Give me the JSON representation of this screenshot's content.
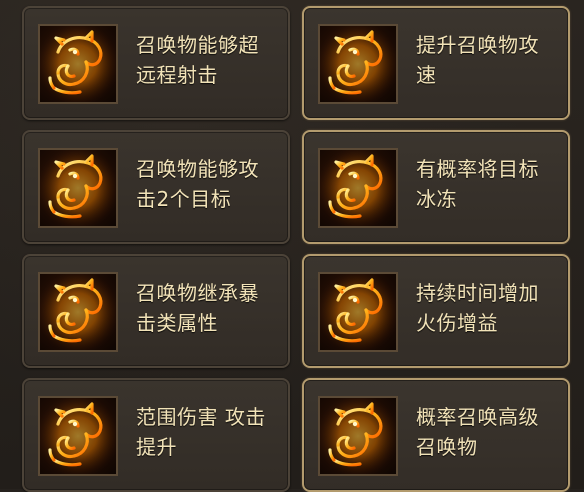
{
  "skills": [
    {
      "label": "召唤物能够超远程射击",
      "line1": "召唤物能够超",
      "line2": "远程射击",
      "icon": "fire-beast-icon",
      "selected": false
    },
    {
      "label": "提升召唤物攻速",
      "line1": "提升召唤物攻",
      "line2": "速",
      "icon": "fire-beast-icon",
      "selected": true
    },
    {
      "label": "召唤物能够攻击2个目标",
      "line1": "召唤物能够攻",
      "line2": "击2个目标",
      "icon": "fire-beast-icon",
      "selected": false
    },
    {
      "label": "有概率将目标冰冻",
      "line1": "有概率将目标",
      "line2": "冰冻",
      "icon": "fire-beast-icon",
      "selected": true
    },
    {
      "label": "召唤物继承暴击类属性",
      "line1": "召唤物继承暴",
      "line2": "击类属性",
      "icon": "fire-beast-icon",
      "selected": false
    },
    {
      "label": "持续时间增加火伤增益",
      "line1": "持续时间增加",
      "line2": "火伤增益",
      "icon": "fire-beast-icon",
      "selected": true
    },
    {
      "label": "范围伤害 攻击提升",
      "line1": "范围伤害 攻击",
      "line2": "提升",
      "icon": "fire-beast-icon",
      "selected": false
    },
    {
      "label": "概率召唤高级召唤物",
      "line1": "概率召唤高级",
      "line2": "召唤物",
      "icon": "fire-beast-icon",
      "selected": true
    }
  ],
  "colors": {
    "label_text": "#f2e3b8",
    "selected_border": "#b39b6e",
    "card_border": "#4c4338",
    "icon_fire": "#ffb21a"
  }
}
